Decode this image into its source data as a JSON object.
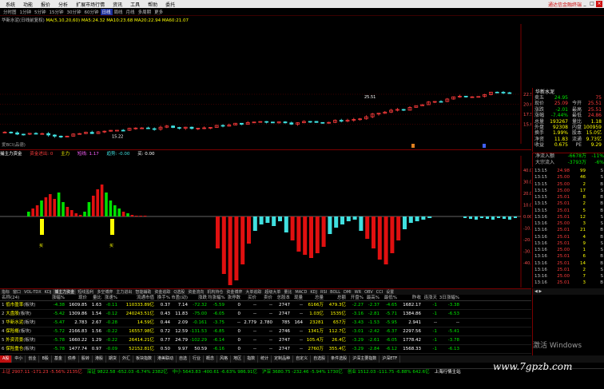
{
  "menu": {
    "items": [
      "系统",
      "功能",
      "报价",
      "分析",
      "扩展市场行情",
      "资讯",
      "工具",
      "帮助",
      "委托"
    ],
    "brand": "通达信金融终端"
  },
  "periods": {
    "items": [
      "分时图",
      "1分钟",
      "5分钟",
      "15分钟",
      "30分钟",
      "60分钟",
      "日线",
      "周线",
      "月线",
      "多周期",
      "更多"
    ],
    "selected": "日线"
  },
  "kline_info": {
    "name": "华新水泥(日线前复权)",
    "ma_text": "MA(5,10,20,60) MA5:24.32 MA10:23.68 MA20:22.94 MA60:21.07"
  },
  "indicator": {
    "label": "爱BCI(品德)",
    "title": "捕主力资金",
    "values": [
      "资金进出: 0",
      "主力",
      "短线: 1.17",
      "趋势: -0.00",
      "买: 0.00"
    ]
  },
  "price_axis": [
    "22.50",
    "20.00",
    "17.50",
    "15.00"
  ],
  "ind_axis": [
    "40.00",
    "30.00",
    "20.00",
    "10.00",
    "0.00",
    "-10.00",
    "-20.00",
    "-30.00",
    "-40.00"
  ],
  "buy_marks": [
    "买",
    "买"
  ],
  "low_mark": "15.22",
  "high_mark": "25.51",
  "tabs": {
    "items": [
      "指标",
      "窗口",
      "VOL-TDX",
      "KDJ",
      "捕主力资金",
      "短线盈利",
      "多空博弈",
      "主力进出",
      "智能辅助",
      "资金追踪",
      "Q选股",
      "资金流向",
      "机构持仓",
      "资金博弈",
      "大单追踪",
      "超级大单",
      "量比",
      "MACD",
      "KDJ",
      "RSI",
      "BOLL",
      "DMI",
      "WR",
      "OBV",
      "CCI",
      "设置"
    ],
    "selected": "捕主力资金"
  },
  "right_quote": {
    "title": "华新水泥",
    "rows": [
      {
        "l1": "卖五",
        "v1": "24.95",
        "l2": "",
        "v2": "75"
      },
      {
        "l1": "现价",
        "v1": "25.09",
        "l2": "今开",
        "v2": "25.51"
      },
      {
        "l1": "涨跌",
        "v1": "-2.01",
        "l2": "最高",
        "v2": "25.51"
      },
      {
        "l1": "涨幅",
        "v1": "-7.44%",
        "l2": "最低",
        "v2": "24.86"
      },
      {
        "l1": "总量",
        "v1": "193267",
        "l2": "量比",
        "v2": "1.18"
      },
      {
        "l1": "外盘",
        "v1": "92308",
        "l2": "内盘",
        "v2": "100959"
      },
      {
        "l1": "换手",
        "v1": "1.99%",
        "l2": "股本",
        "v2": "15.0亿"
      },
      {
        "l1": "净资",
        "v1": "11.83",
        "l2": "流通",
        "v2": "9.73亿"
      },
      {
        "l1": "收益",
        "v1": "0.675",
        "l2": "PE",
        "v2": "9.29"
      }
    ]
  },
  "right_flow": [
    {
      "a": "净流入额",
      "b": "-6678万",
      "c": "-11%"
    },
    {
      "a": "大宗流入",
      "b": "-3793万",
      "c": "-6%"
    }
  ],
  "ticks": [
    {
      "t": "13:15",
      "p": "24.98",
      "v": "99",
      "n": "S"
    },
    {
      "t": "13:15",
      "p": "25.00",
      "v": "46",
      "n": "S"
    },
    {
      "t": "13:15",
      "p": "25.00",
      "v": "2",
      "n": "B"
    },
    {
      "t": "13:15",
      "p": "25.00",
      "v": "17",
      "n": "S"
    },
    {
      "t": "13:15",
      "p": "25.01",
      "v": "8",
      "n": "B"
    },
    {
      "t": "13:15",
      "p": "25.01",
      "v": "2",
      "n": "B"
    },
    {
      "t": "13:15",
      "p": "25.01",
      "v": "5",
      "n": "B"
    },
    {
      "t": "13:16",
      "p": "25.01",
      "v": "12",
      "n": "S"
    },
    {
      "t": "13:16",
      "p": "25.00",
      "v": "3",
      "n": "S"
    },
    {
      "t": "13:16",
      "p": "25.01",
      "v": "21",
      "n": "B"
    },
    {
      "t": "13:16",
      "p": "25.01",
      "v": "4",
      "n": "B"
    },
    {
      "t": "13:16",
      "p": "25.01",
      "v": "9",
      "n": "S"
    },
    {
      "t": "13:16",
      "p": "25.00",
      "v": "1",
      "n": "S"
    },
    {
      "t": "13:16",
      "p": "25.01",
      "v": "6",
      "n": "B"
    },
    {
      "t": "13:16",
      "p": "25.01",
      "v": "14",
      "n": "B"
    },
    {
      "t": "13:16",
      "p": "25.01",
      "v": "2",
      "n": "S"
    },
    {
      "t": "13:16",
      "p": "25.00",
      "v": "7",
      "n": "S"
    },
    {
      "t": "13:16",
      "p": "25.01",
      "v": "3",
      "n": "B"
    }
  ],
  "table": {
    "headers": [
      "名称(24)",
      "涨幅%",
      "现价",
      "量比",
      "涨速%",
      "流通市值",
      "换手%",
      "市盈(动)",
      "涨跌",
      "均涨幅%",
      "涨停数",
      "买价",
      "卖价",
      "总股本",
      "现量",
      "总量",
      "总额",
      "开盘%",
      "最高%",
      "最低%",
      "昨收",
      "连涨天",
      "3日涨幅%"
    ],
    "rows": [
      {
        "idx": "1",
        "name": "低市盈率",
        "tag": "(板块)",
        "cells": [
          "-4.38",
          "1609.85",
          "1.63",
          "-0.11",
          "110333.89亿",
          "0.37",
          "7.14",
          "-72.32",
          "-5.59",
          "0",
          "--",
          "--",
          "2747",
          "--",
          "6166万",
          "479.3亿",
          "-2.27",
          "-2.37",
          "-4.65",
          "1682.17",
          "-1",
          "-3.38"
        ]
      },
      {
        "idx": "2",
        "name": "大盘股",
        "tag": "(板块)",
        "cells": [
          "-5.42",
          "1309.86",
          "1.54",
          "-0.12",
          "240243.51亿",
          "0.43",
          "11.83",
          "-75.00",
          "-6.05",
          "0",
          "--",
          "--",
          "2747",
          "--",
          "1.03亿",
          "1535亿",
          "-3.16",
          "-2.81",
          "-5.71",
          "1384.86",
          "-1",
          "-6.53"
        ]
      },
      {
        "idx": "3",
        "name": "华新水泥",
        "tag": "(板块)",
        "cells": [
          "-5.47",
          "2.783",
          "2.67",
          "-0.28",
          "14.59亿",
          "0.44",
          "2.09",
          "-0.161",
          "-3.75",
          "--",
          "2.779",
          "2.780",
          "785",
          "164",
          "23281",
          "657万",
          "-3.43",
          "-1.53",
          "-5.95",
          "2.941",
          "--",
          "--"
        ]
      },
      {
        "idx": "4",
        "name": "保险概",
        "tag": "(板块)",
        "cells": [
          "-5.72",
          "2166.83",
          "1.56",
          "-0.22",
          "16557.98亿",
          "0.72",
          "12.59",
          "-131.53",
          "-6.85",
          "0",
          "--",
          "--",
          "2746",
          "--",
          "1341万",
          "112.7亿",
          "-3.01",
          "-2.42",
          "-6.37",
          "2297.56",
          "-1",
          "-5.41"
        ]
      },
      {
        "idx": "5",
        "name": "外资背景",
        "tag": "(板块)",
        "cells": [
          "-5.78",
          "1660.22",
          "1.29",
          "-0.22",
          "26414.21亿",
          "0.77",
          "24.79",
          "-102.29",
          "-6.14",
          "0",
          "--",
          "--",
          "2747",
          "--",
          "105.4万",
          "26.4亿",
          "-3.29",
          "-2.61",
          "-6.05",
          "1778.42",
          "-1",
          "-3.78"
        ]
      },
      {
        "idx": "6",
        "name": "保险重仓",
        "tag": "(板块)",
        "cells": [
          "-5.78",
          "1477.74",
          "0.97",
          "-0.09",
          "52152.81亿",
          "0.50",
          "9.97",
          "50.59",
          "-6.16",
          "0",
          "--",
          "--",
          "2747",
          "--",
          "2760万",
          "355.4亿",
          "-3.29",
          "-2.84",
          "-6.12",
          "1568.33",
          "-1",
          "-6.13"
        ]
      }
    ]
  },
  "bottom_tabs": {
    "items": [
      "A股",
      "中小",
      "创业",
      "B股",
      "基金",
      "债券",
      "股转",
      "港股",
      "期货",
      "外汇",
      "板块指数",
      "港美联动",
      "自选",
      "行业",
      "概念",
      "风格",
      "地区",
      "指数",
      "统计",
      "定制品种",
      "自定义",
      "自选股",
      "条件选股",
      "沪深主要指数",
      "沪深ETF"
    ],
    "selected": "A股"
  },
  "status": [
    {
      "t": "上证 2907.11 -171.23 -5.56% 2135亿",
      "c": "red"
    },
    {
      "t": "深证 9822.58 -652.03 -6.74% 2382亿",
      "c": "grn"
    },
    {
      "t": "中小 5643.83 -400.61 -6.63% 986.91亿",
      "c": "grn"
    },
    {
      "t": "沪深 3680.75 -232.46 -5.94% 1730亿",
      "c": "grn"
    },
    {
      "t": "创业 1512.03 -111.75 -6.88% 642.6亿",
      "c": "grn"
    },
    {
      "t": "上海行情主站",
      "c": "wht"
    }
  ],
  "watermarks": [
    "激活 Windows",
    "www.7gpzb.com"
  ]
}
